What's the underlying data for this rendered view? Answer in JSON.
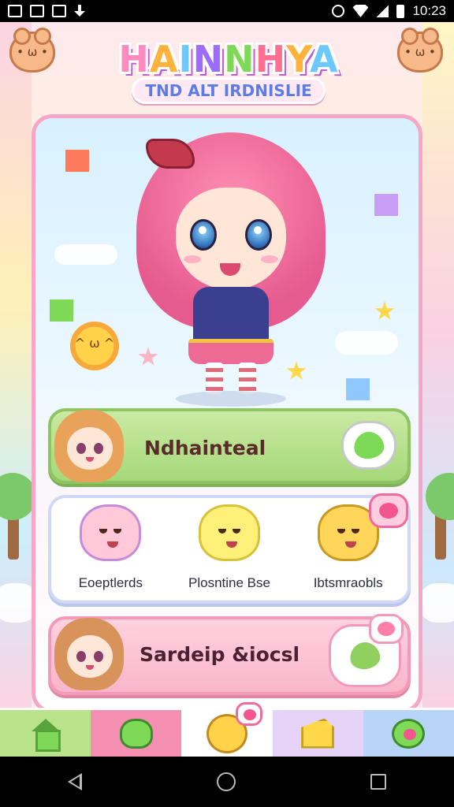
{
  "status_bar": {
    "time": "10:23"
  },
  "logo": {
    "title": "HAINNHYA",
    "subtitle": "TND ALT IRDNISLIE"
  },
  "cards": {
    "main": {
      "label": "Ndhainteal"
    },
    "friends": [
      {
        "name": "Eoeptlerds"
      },
      {
        "name": "Plosntine Bse"
      },
      {
        "name": "Ibtsmraobls"
      }
    ],
    "social": {
      "label": "Sardeip &iocsl"
    }
  },
  "tabs": [
    {
      "icon": "home-icon"
    },
    {
      "icon": "frog-icon"
    },
    {
      "icon": "smile-heart-icon"
    },
    {
      "icon": "cheese-icon"
    },
    {
      "icon": "bug-icon"
    }
  ],
  "colors": {
    "panel_border": "#f6a7c8",
    "green_card": "#a6d87a",
    "pink_card": "#f9b6ca",
    "accent_heart": "#f2558f"
  }
}
